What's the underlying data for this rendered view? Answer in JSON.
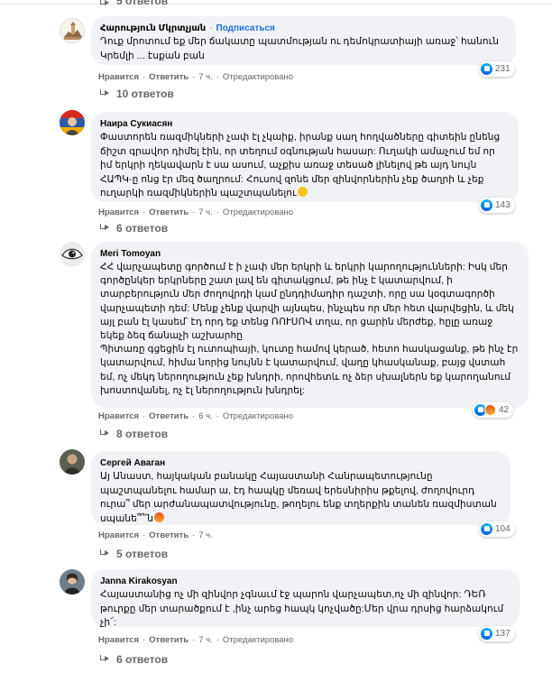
{
  "top_replies": {
    "label": "5 ответов"
  },
  "comments": [
    {
      "author": "Հարություն Մկրտչյան",
      "subscribe": "Подписаться",
      "text": "Դուք մրոտում եք մեր ճակատը պատմության ու դեմոկրատիայի առաջ՝ հանուն Կրեմլի ... էսքան բան",
      "like": "Нравится",
      "reply": "Ответить",
      "time": "7 ч.",
      "edited": "Отредактировано",
      "reaction_count": "231",
      "reactions": [
        "like"
      ],
      "replies_label": "10 ответов",
      "avatar": "church-avatar"
    },
    {
      "author": "Наира Сукиасян",
      "text": "Փաստորեն ռազմիկների չափ էլ չկաիք, իրանք սաղ հողվածները գիտեին ընենց ճիշտ գրավոր դիմել էին, որ տեղում օգնության հասար: Ուղակի ամաչում եմ որ իմ երկրի ղեկավարն է սա ասում, աչքիս առաջ տեսած լինելով թե այդ նույն ՀԱՊԿ-ը ոնց էր մեզ ծաղրում: Հուսով զոնե մեր զինվորներին չեք ծաղրի և չեք ուղարկի ռազմիկներին պաշտպանելու",
      "like": "Нравится",
      "reply": "Ответить",
      "time": "7 ч.",
      "edited": "Отредактировано",
      "reaction_count": "143",
      "reactions": [
        "like"
      ],
      "replies_label": "6 ответов",
      "avatar": "flag-avatar"
    },
    {
      "author": "Meri Tomoyan",
      "text": "ՀՀ վարչապետը գործում է ի չափ մեր երկրի և երկրի կարողությունների: Իսկ մեր գործընկեր երկրները շատ լավ են գիտակցում, թե ինչ է կատարվում, ի տարբերություն մեր ժողովրդի կամ ընդդիմադիր դաշտի, որը սա կօգտագործի վարչապետի դեմ: Մենք չենք վարվի այնպես, ինչպես որ մեր հետ վարվեցին, և մեկ այլ բան էլ կասեմ՝ էդ որդ եք տենց ՌՈՒՍՈՎ տղա, որ ցարին մերժեք, հըլը առաջ եկեք ձեզ ճանաչի աշխարհը\nՊիտառը գցեցին էլ ուտոպիայի, կուտը համով կերած, հետո հասկացանք, թե ինչ էր կատարվում, հիմա նորից նույնն է կատարվում, վաղը կհասկանաք, բայց վստահ եմ, ոչ մեկդ ներողություն չեք խնդրի, որովհետև ոչ ձեր սխալներն եք կարողանում խոստովանել, ոչ էլ ներողություն խնդրել:",
      "like": "Нравится",
      "reply": "Ответить",
      "time": "6 ч.",
      "edited": "Отредактировано",
      "reaction_count": "42",
      "reactions": [
        "like",
        "angry"
      ],
      "replies_label": "8 ответов",
      "avatar": "eye-avatar"
    },
    {
      "author": "Сергей Аваган",
      "text": "Այ Անաստ, հայկական բանակը Հայաստանի Հանրապետությունը պաշտպանելու համար ա, էդ հապկը մեռավ երեսնիրիս թքելով, ժողովուրդ ուրա՞ մեր արժանապատվությունը, թողելու ենք տղերքին տանեն ռազմիստան սպանե՞՞՛ն",
      "like": "Нравится",
      "reply": "Ответить",
      "time": "7 ч.",
      "edited": "",
      "reaction_count": "104",
      "reactions": [
        "like"
      ],
      "replies_label": "5 ответов",
      "avatar": "man-avatar"
    },
    {
      "author": "Janna Kirakosyan",
      "text": "Հայաստանից ոչ մի զինվոր չգնաւմ էջ պարոն վարչապետ,ոչ մի զինվոր: ԴԵՌ թուրքը մեր տարածքում է ,ինչ արեց հապկ կոչվածը:Մեր վրա դրսից հարձակում չի՜:",
      "like": "Нравится",
      "reply": "Ответить",
      "time": "7 ч.",
      "edited": "Отредактировано",
      "reaction_count": "137",
      "reactions": [
        "like"
      ],
      "replies_label": "6 ответов",
      "avatar": "portrait-avatar"
    }
  ]
}
